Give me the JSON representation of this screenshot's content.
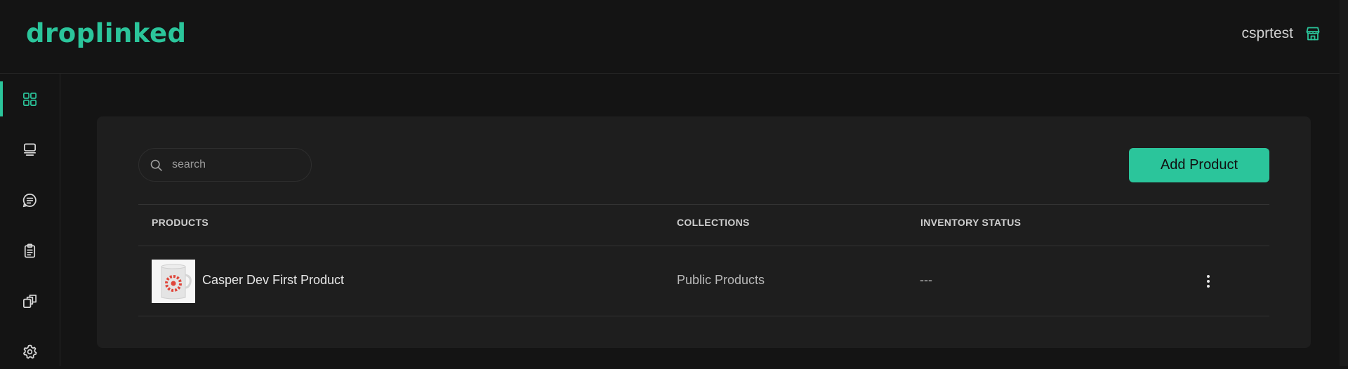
{
  "app": {
    "logo": "droplinked",
    "accent_color": "#2bc59b"
  },
  "header": {
    "username": "csprtest",
    "user_icon": "store-icon"
  },
  "sidebar": {
    "items": [
      {
        "icon": "dashboard-grid-icon",
        "active": true
      },
      {
        "icon": "products-icon",
        "active": false
      },
      {
        "icon": "collections-icon",
        "active": false
      },
      {
        "icon": "orders-clipboard-icon",
        "active": false
      },
      {
        "icon": "cards-icon",
        "active": false
      },
      {
        "icon": "settings-gear-icon",
        "active": false
      }
    ]
  },
  "toolbar": {
    "search_placeholder": "search",
    "add_product_label": "Add Product"
  },
  "table": {
    "headers": {
      "products": "PRODUCTS",
      "collections": "COLLECTIONS",
      "inventory": "INVENTORY STATUS"
    },
    "rows": [
      {
        "product": "Casper Dev First Product",
        "collection": "Public Products",
        "inventory": "---"
      }
    ]
  }
}
